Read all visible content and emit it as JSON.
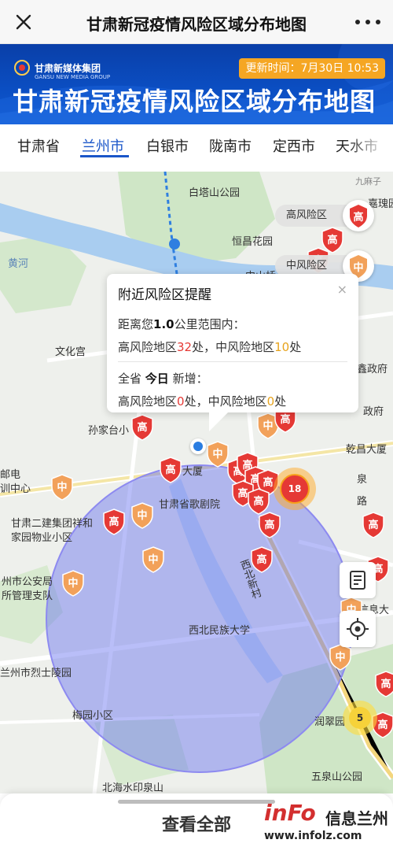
{
  "nav": {
    "title": "甘肃新冠疫情风险区域分布地图"
  },
  "banner": {
    "logo_cn": "甘肃新媒体集团",
    "logo_en": "GANSU NEW MEDIA GROUP",
    "update_time": "更新时间：7月30日 10:53",
    "title": "甘肃新冠疫情风险区域分布地图"
  },
  "tabs": [
    "甘肃省",
    "兰州市",
    "白银市",
    "陇南市",
    "定西市",
    "天水市"
  ],
  "active_tab": "兰州市",
  "map_labels": {
    "l1": "白塔山公园",
    "l2": "恒昌花园",
    "l3": "文化宫",
    "l4": "孙家台小",
    "l5": "甘肃省歌剧院",
    "l6": "甘肃二建集团祥和",
    "l7": "家园物业小区",
    "l8": "州市公安局",
    "l9": "所管理支队",
    "l10": "西北民族大学",
    "l11": "兰州市烈士陵园",
    "l12": "梅园小区",
    "l13": "北海水印泉山",
    "l14": "五泉山公园",
    "l15": "润翠园",
    "l16": "乾昌大厦",
    "l17": "泉",
    "l18": "路",
    "l19": "西北新村",
    "l20": "信息大",
    "l21": "鑫政府",
    "l22": "政府",
    "l23": "邮电",
    "l24": "训中心",
    "l25": "大厦",
    "l26": "九麻子",
    "l27": "嘉瑰园",
    "l28": "黄河",
    "l29": "中山桥",
    "l30": "北"
  },
  "legend": {
    "high": "高风险区",
    "mid": "中风险区",
    "high_badge": "高",
    "mid_badge": "中"
  },
  "marker_text": {
    "high": "高",
    "mid": "中"
  },
  "clusters": {
    "c18": "18",
    "c5": "5"
  },
  "popup": {
    "title": "附近风险区提醒",
    "close": "×",
    "distance_prefix": "距离您",
    "distance_value": "1.0",
    "distance_suffix": "公里范围内：",
    "high_prefix": "高风险地区",
    "high_count": "32",
    "high_unit": "处，",
    "mid_prefix": "中风险地区",
    "mid_count": "10",
    "mid_unit": "处",
    "province_prefix": "全省",
    "today": "今日",
    "new_label": "新增：",
    "today_high_prefix": "高风险地区",
    "today_high_count": "0",
    "today_high_unit": "处，",
    "today_mid_prefix": "中风险地区",
    "today_mid_count": "0",
    "today_mid_unit": "处"
  },
  "bottom": {
    "view_all": "查看全部"
  },
  "watermark": {
    "logo": "inFo",
    "cn": "信息兰州",
    "url": "www.infolz.com"
  },
  "colors": {
    "high": "#e53935",
    "mid": "#f2a15a",
    "accent": "#1a56c9",
    "radius": "#6e6ef0"
  },
  "icons": {
    "close": "close-icon",
    "more": "more-dots-icon",
    "locate": "locate-icon",
    "list": "list-icon"
  }
}
